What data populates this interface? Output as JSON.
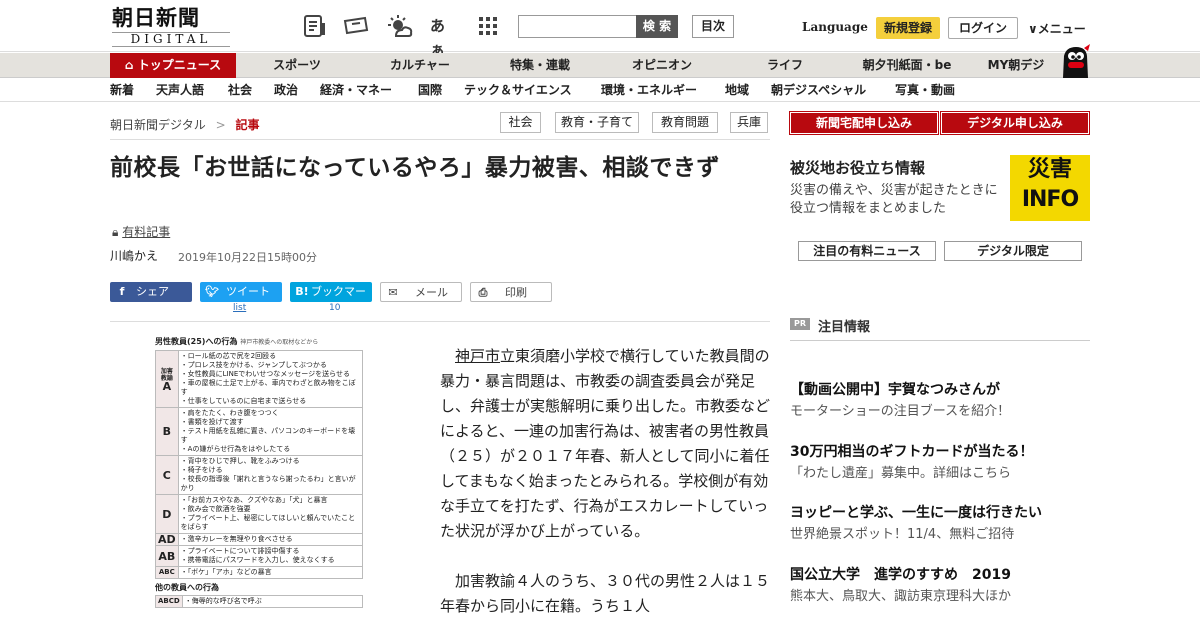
{
  "header": {
    "logo_main": "朝日新聞",
    "logo_sub": "DIGITAL",
    "font_toggle": "あぁ",
    "search_button": "検 索",
    "toc_button": "目次",
    "language": "Language",
    "register": "新規登録",
    "login": "ログイン",
    "menu": "メニュー",
    "icons": [
      "newspaper-icon",
      "ticket-icon",
      "weather-icon",
      "font-size-icon",
      "grid-icon"
    ]
  },
  "main_nav": [
    "トップニュース",
    "スポーツ",
    "カルチャー",
    "特集・連載",
    "オピニオン",
    "ライフ",
    "朝夕刊紙面・be",
    "MY朝デジ"
  ],
  "sub_nav": [
    "新着",
    "天声人語",
    "社会",
    "政治",
    "経済・マネー",
    "国際",
    "テック＆サイエンス",
    "環境・エネルギー",
    "地域",
    "朝デジスペシャル",
    "写真・動画"
  ],
  "breadcrumb": {
    "home": "朝日新聞デジタル",
    "sep": ">",
    "current": "記事"
  },
  "tags": [
    "社会",
    "教育・子育て",
    "教育問題",
    "兵庫"
  ],
  "article": {
    "title": "前校長「お世話になっているやろ」暴力被害、相談できず",
    "paid_label": "有料記事",
    "author": "川嶋かえ",
    "date": "2019年10月22日15時00分",
    "p1_kw": "神戸市",
    "p1_rest": "立東須磨小学校で横行していた教員間の暴力・暴言問題は、市教委の調査委員会が発足し、弁護士が実態解明に乗り出した。市教委などによると、一連の加害行為は、被害者の男性教員（２５）が２０１７年春、新人として同小に着任してまもなく始まったとみられる。学校側が有効な手立てを打たず、行為がエスカレートしていった状況が浮かび上がっている。",
    "p2": "加害教諭４人のうち、３０代の男性２人は１５年春から同小に在籍。うち１人"
  },
  "share": {
    "facebook": "シェア",
    "twitter": "ツイート",
    "hatena": "ブックマーク",
    "mail": "メール",
    "print": "印刷",
    "twitter_count": "list",
    "hatena_count": "10"
  },
  "figure": {
    "heading": "男性教員(25)への行為",
    "source": "神戸市教委への取材などから",
    "rows": [
      {
        "label": "A",
        "label_top": "加害教諭",
        "items": [
          "・ロール紙の芯で尻を2回殴る",
          "・プロレス技をかける、ジャンプしてぶつかる",
          "・女性教員にLINEでわいせつなメッセージを送らせる",
          "・車の屋根に土足で上がる、車内でわざと飲み物をこぼす",
          "・仕事をしているのに自宅まで送らせる"
        ]
      },
      {
        "label": "B",
        "label_top": "",
        "items": [
          "・肩をたたく、わき腹をつつく",
          "・書類を投げて渡す",
          "・テスト用紙を乱雑に置き、パソコンのキーボードを壊す",
          "・Aの嫌がらせ行為をはやしたてる"
        ]
      },
      {
        "label": "C",
        "label_top": "",
        "items": [
          "・背中をひじで押し、靴をふみつける",
          "・椅子をける",
          "・校長の指導後「謝れと言うなら謝ったるわ」と言いがかり"
        ]
      },
      {
        "label": "D",
        "label_top": "",
        "items": [
          "・「お前カスやなあ、クズやなあ」「犬」と暴言",
          "・飲み会で飲酒を強要",
          "・プライベート上、秘密にしてほしいと頼んでいたことをばらす"
        ]
      },
      {
        "label": "AD",
        "label_top": "",
        "items": [
          "・激辛カレーを無理やり食べさせる"
        ]
      },
      {
        "label": "AB",
        "label_top": "",
        "items": [
          "・プライベートについて誹謗中傷する",
          "・携帯電話にパスワードを入力し、使えなくする"
        ]
      },
      {
        "label": "ABC",
        "label_top": "",
        "items": [
          "・「ボケ」「アホ」などの暴言"
        ]
      }
    ],
    "other_heading": "他の教員への行為",
    "other_rows": [
      {
        "label": "ABCD",
        "items": [
          "・侮辱的な呼び名で呼ぶ"
        ]
      }
    ]
  },
  "sidebar": {
    "order_delivery": "新聞宅配申し込み",
    "order_digital": "デジタル申し込み",
    "saigai_title": "被災地お役立ち情報",
    "saigai_desc": "災害の備えや、災害が起きたときに役立つ情報をまとめました",
    "saigai_logo_top": "災害",
    "saigai_logo_bottom": "INFO",
    "btn_paid_news": "注目の有料ニュース",
    "btn_digital_only": "デジタル限定",
    "pr_badge": "PR",
    "pr_title": "注目情報",
    "pr_items": [
      {
        "title": "【動画公開中】宇賀なつみさんが",
        "desc": "モーターショーの注目ブースを紹介！"
      },
      {
        "title": "30万円相当のギフトカードが当たる！",
        "desc": "「わたし遺産」募集中。詳細はこちら"
      },
      {
        "title": "ヨッピーと学ぶ、一生に一度は行きたい",
        "desc": "世界絶景スポット！11/4、無料ご招待"
      },
      {
        "title": "国公立大学　進学のすすめ　2019",
        "desc": "熊本大、鳥取大、諏訪東京理科大ほか"
      }
    ]
  }
}
